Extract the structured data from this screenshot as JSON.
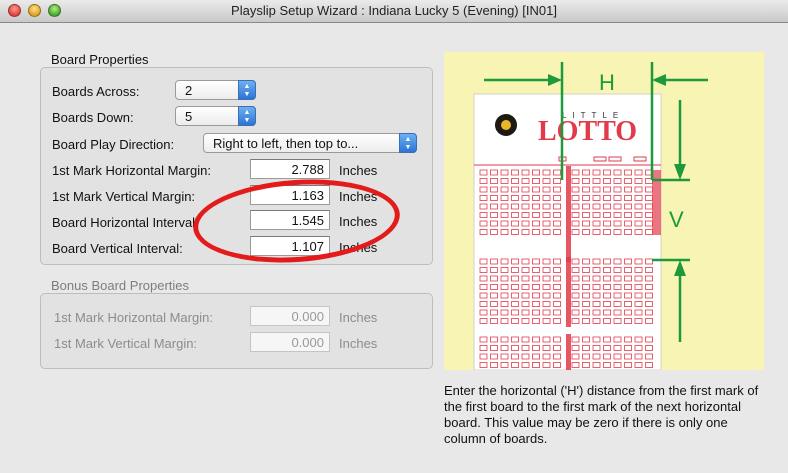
{
  "window": {
    "title": "Playslip Setup Wizard : Indiana Lucky 5 (Evening) [IN01]"
  },
  "board_properties": {
    "title": "Board Properties",
    "boards_across_label": "Boards Across:",
    "boards_across_value": "2",
    "boards_down_label": "Boards Down:",
    "boards_down_value": "5",
    "play_direction_label": "Board Play Direction:",
    "play_direction_value": "Right to left, then top to...",
    "h_margin_label": "1st Mark Horizontal Margin:",
    "h_margin_value": "2.788",
    "v_margin_label": "1st Mark Vertical Margin:",
    "v_margin_value": "1.163",
    "h_interval_label": "Board Horizontal Interval:",
    "h_interval_value": "1.545",
    "v_interval_label": "Board Vertical Interval:",
    "v_interval_value": "1.107",
    "unit": "Inches"
  },
  "bonus_board_properties": {
    "title": "Bonus Board Properties",
    "h_margin_label": "1st Mark Horizontal Margin:",
    "h_margin_value": "0.000",
    "v_margin_label": "1st Mark Vertical Margin:",
    "v_margin_value": "0.000",
    "unit": "Inches"
  },
  "diagram": {
    "h_label": "H",
    "v_label": "V",
    "logo_top": "LITTLE",
    "logo_main": "LOTTO",
    "slip_color": "#e23a4a",
    "guide_color": "#1f9a3a",
    "background_color": "#f7f4b4"
  },
  "help_text": "Enter the horizontal ('H') distance from the first mark of the first board to the first mark of the next horizontal board. This value may be zero if there is only one column of boards."
}
